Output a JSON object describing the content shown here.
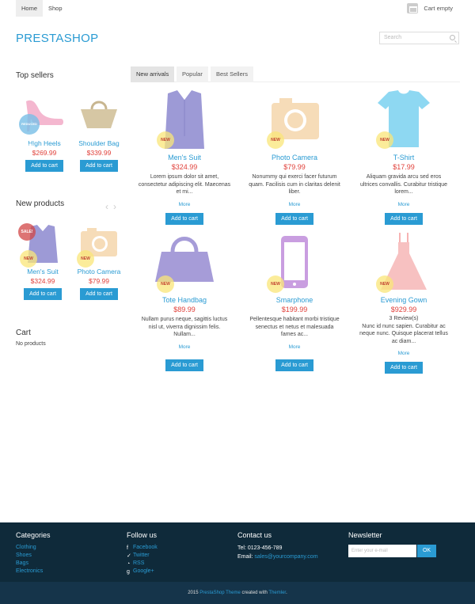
{
  "nav": {
    "home": "Home",
    "shop": "Shop"
  },
  "header": {
    "cart": "Cart empty",
    "logo": "PRESTASHOP",
    "search_placeholder": "Search"
  },
  "sidebar": {
    "top_sellers_title": "Top sellers",
    "top_sellers": [
      {
        "name": "High Heels",
        "price": "$269.99",
        "button": "Add to cart",
        "badge": "REDUCED PRICE"
      },
      {
        "name": "Shoulder Bag",
        "price": "$339.99",
        "button": "Add to cart"
      }
    ],
    "new_products_title": "New products",
    "new_products": [
      {
        "name": "Men's Suit",
        "price": "$324.99",
        "button": "Add to cart",
        "badge_sale": "SALE!",
        "badge_new": "NEW"
      },
      {
        "name": "Photo Camera",
        "price": "$79.99",
        "button": "Add to cart",
        "badge_new": "NEW"
      }
    ],
    "cart_title": "Cart",
    "cart_empty": "No products"
  },
  "tabs": [
    "New arrivals",
    "Popular",
    "Best Sellers"
  ],
  "products": [
    {
      "name": "Men's Suit",
      "price": "$324.99",
      "desc": "Lorem ipsum dolor sit amet, consectetur adipiscing elit. Maecenas et mi...",
      "more": "More",
      "button": "Add to cart",
      "badge": "NEW"
    },
    {
      "name": "Photo Camera",
      "price": "$79.99",
      "desc": "Nonummy qui exerci facer futurum quam. Facilisis cum in claritas delenit liber.",
      "more": "More",
      "button": "Add to cart",
      "badge": "NEW"
    },
    {
      "name": "T-Shirt",
      "price": "$17.99",
      "desc": "Aliquam gravida arcu sed eros ultrices convallis. Curabitur tristique lorem...",
      "more": "More",
      "button": "Add to cart",
      "badge": "NEW"
    },
    {
      "name": "Tote Handbag",
      "price": "$89.99",
      "desc": "Nullam purus neque, sagittis luctus nisl ut, viverra dignissim felis. Nullam...",
      "more": "More",
      "button": "Add to cart",
      "badge": "NEW"
    },
    {
      "name": "Smarphone",
      "price": "$199.99",
      "desc": "Pellentesque habitant morbi tristique senectus et netus et malesuada fames ac...",
      "more": "More",
      "button": "Add to cart",
      "badge": "NEW"
    },
    {
      "name": "Evening Gown",
      "price": "$929.99",
      "reviews": "3 Review(s)",
      "desc": "Nunc id nunc sapien. Curabitur ac neque nunc. Quisque placerat tellus ac diam...",
      "more": "More",
      "button": "Add to cart",
      "badge": "NEW"
    }
  ],
  "footer": {
    "categories_title": "Categories",
    "categories": [
      "Clothing",
      "Shoes",
      "Bags",
      "Electronics"
    ],
    "follow_title": "Follow us",
    "follow": [
      "Facebook",
      "Twitter",
      "RSS",
      "Google+"
    ],
    "contact_title": "Contact us",
    "tel": "Tel: 0123-456-789",
    "email_label": "Email: ",
    "email": "sales@yourcompany.com",
    "newsletter_title": "Newsletter",
    "newsletter_placeholder": "Enter your e-mail",
    "newsletter_button": "OK",
    "copy_year": "2015 ",
    "copy_theme": "PrestaShop Theme",
    "copy_mid": " created with ",
    "copy_brand": "Themler",
    "copy_end": "."
  }
}
